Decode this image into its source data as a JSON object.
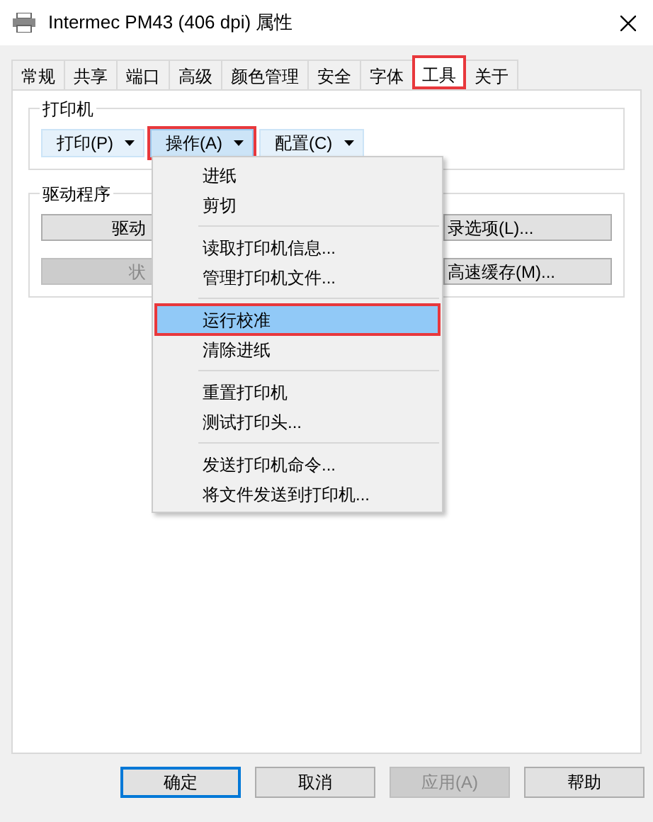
{
  "window": {
    "title": "Intermec PM43 (406 dpi) 属性"
  },
  "tabs": [
    {
      "label": "常规",
      "selected": false,
      "highlighted": false
    },
    {
      "label": "共享",
      "selected": false,
      "highlighted": false
    },
    {
      "label": "端口",
      "selected": false,
      "highlighted": false
    },
    {
      "label": "高级",
      "selected": false,
      "highlighted": false
    },
    {
      "label": "颜色管理",
      "selected": false,
      "highlighted": false
    },
    {
      "label": "安全",
      "selected": false,
      "highlighted": false
    },
    {
      "label": "字体",
      "selected": false,
      "highlighted": false
    },
    {
      "label": "工具",
      "selected": true,
      "highlighted": true
    },
    {
      "label": "关于",
      "selected": false,
      "highlighted": false
    }
  ],
  "printer_group": {
    "title": "打印机",
    "buttons": [
      {
        "label": "打印(P)",
        "pressed": false,
        "highlighted": false
      },
      {
        "label": "操作(A)",
        "pressed": true,
        "highlighted": true
      },
      {
        "label": "配置(C)",
        "pressed": false,
        "highlighted": false
      }
    ]
  },
  "driver_group": {
    "title": "驱动程序",
    "rows": [
      [
        {
          "label": "驱动",
          "disabled": false
        },
        {
          "label": "录选项(L)...",
          "disabled": false
        }
      ],
      [
        {
          "label": "状",
          "disabled": true
        },
        {
          "label": "高速缓存(M)...",
          "disabled": false
        }
      ]
    ]
  },
  "menu": {
    "groups": [
      [
        {
          "label": "进纸",
          "selected": false,
          "highlighted": false
        },
        {
          "label": "剪切",
          "selected": false,
          "highlighted": false
        }
      ],
      [
        {
          "label": "读取打印机信息...",
          "selected": false,
          "highlighted": false
        },
        {
          "label": "管理打印机文件...",
          "selected": false,
          "highlighted": false
        }
      ],
      [
        {
          "label": "运行校准",
          "selected": true,
          "highlighted": true
        },
        {
          "label": "清除进纸",
          "selected": false,
          "highlighted": false
        }
      ],
      [
        {
          "label": "重置打印机",
          "selected": false,
          "highlighted": false
        },
        {
          "label": "测试打印头...",
          "selected": false,
          "highlighted": false
        }
      ],
      [
        {
          "label": "发送打印机命令...",
          "selected": false,
          "highlighted": false
        },
        {
          "label": "将文件发送到打印机...",
          "selected": false,
          "highlighted": false
        }
      ]
    ]
  },
  "buttons": [
    {
      "label": "确定",
      "default": true,
      "disabled": false
    },
    {
      "label": "取消",
      "default": false,
      "disabled": false
    },
    {
      "label": "应用(A)",
      "default": false,
      "disabled": true
    },
    {
      "label": "帮助",
      "default": false,
      "disabled": false
    }
  ]
}
